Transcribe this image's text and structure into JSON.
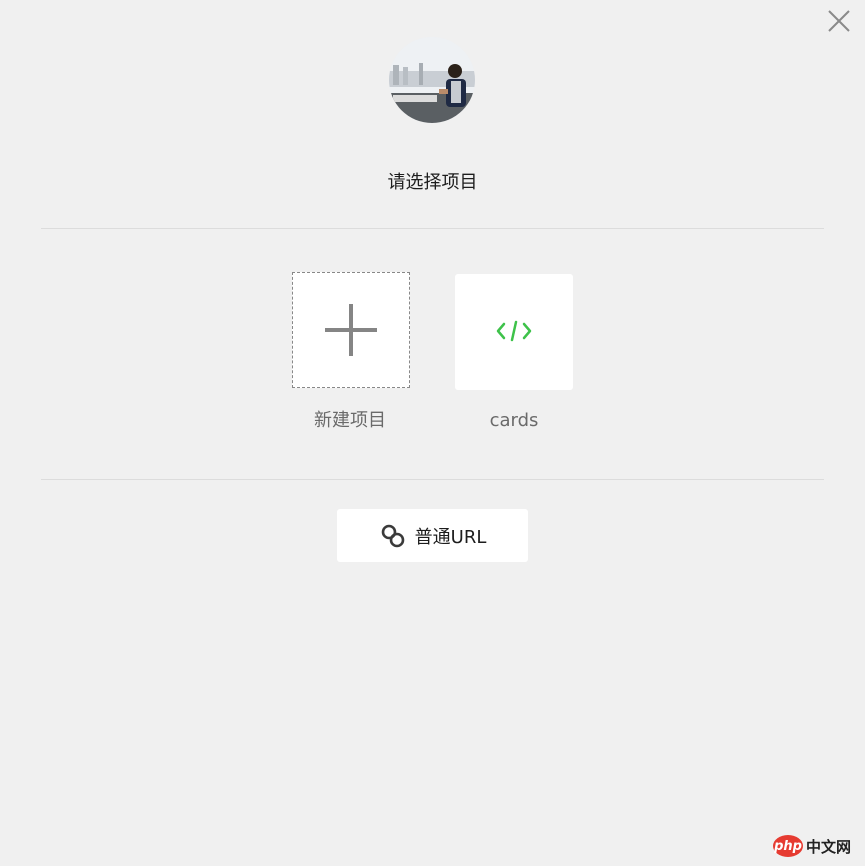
{
  "dialog": {
    "title": "请选择项目",
    "close_icon": "close-icon"
  },
  "projects": {
    "new_label": "新建项目",
    "new_icon": "plus-icon",
    "items": [
      {
        "label": "cards",
        "icon": "code-icon",
        "icon_color": "#3ec24a"
      }
    ]
  },
  "url_button": {
    "label": "普通URL",
    "icon": "link-icon"
  },
  "watermark": {
    "badge": "php",
    "text": "中文网"
  }
}
